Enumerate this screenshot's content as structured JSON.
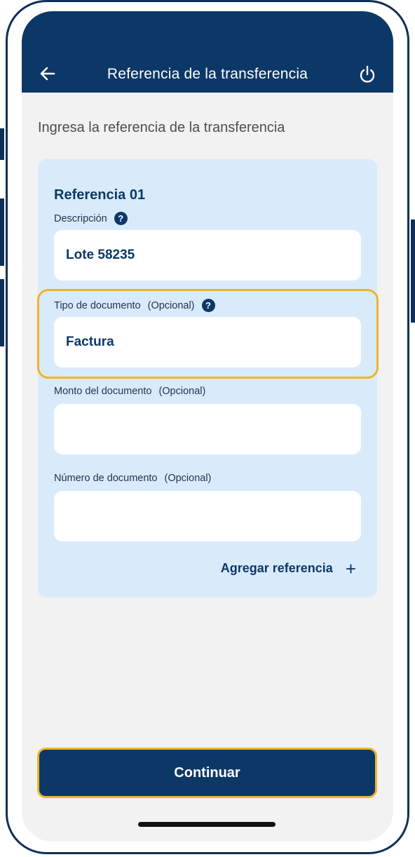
{
  "header": {
    "title": "Referencia de la transferencia",
    "back_icon": "arrow-left-icon",
    "power_icon": "power-icon",
    "background": "#0c3867"
  },
  "instruction": "Ingresa la referencia de la transferencia",
  "reference": {
    "title": "Referencia 01",
    "fields": [
      {
        "label": "Descripción",
        "optional": "",
        "value": "Lote 58235",
        "help": true
      },
      {
        "label": "Tipo de documento",
        "optional": "(Opcional)",
        "value": "Factura",
        "help": true
      },
      {
        "label": "Monto del documento",
        "optional": "(Opcional)",
        "value": "",
        "help": false
      },
      {
        "label": "Número de documento",
        "optional": "(Opcional)",
        "value": "",
        "help": false
      }
    ],
    "add_label": "Agregar referencia",
    "add_icon": "+"
  },
  "continue_label": "Continuar",
  "colors": {
    "primary": "#0c3867",
    "card": "#d9ebfb",
    "highlight": "#f0b429",
    "background": "#f2f2f2"
  }
}
